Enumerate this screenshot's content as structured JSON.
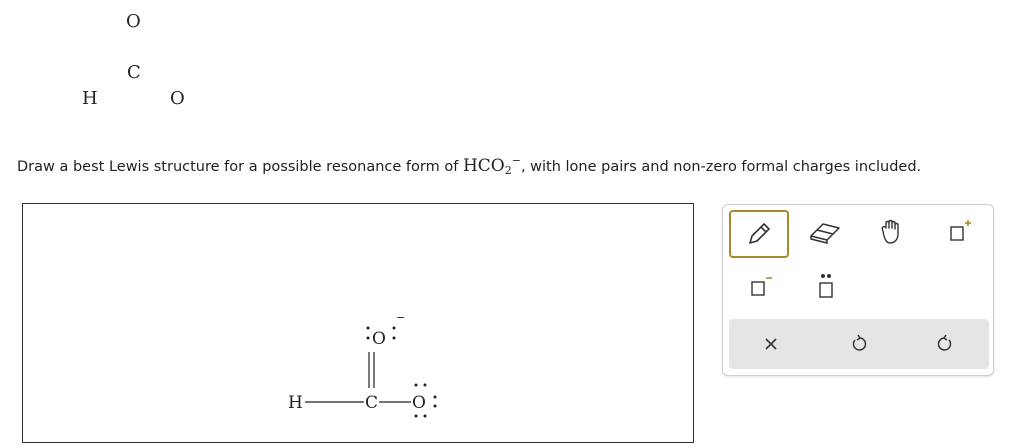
{
  "atoms": {
    "o_top": "O",
    "c": "C",
    "h": "H",
    "o_right": "O"
  },
  "question": {
    "prefix": "Draw a best Lewis structure for a possible resonance form of ",
    "formula_main": "HCO",
    "formula_sub": "2",
    "formula_charge": "−",
    "suffix": ", with lone pairs and non-zero formal charges included."
  },
  "structure": {
    "h": "H",
    "c": "C",
    "o_top": "O",
    "o_right": "O",
    "charge_top": "−"
  },
  "toolbox": {
    "tools": [
      "pencil-icon",
      "eraser-icon",
      "hand-icon",
      "positive-charge-icon",
      "negative-charge-icon",
      "lone-pair-icon"
    ],
    "actions": [
      "clear-icon",
      "undo-icon",
      "redo-icon"
    ],
    "accent": "#a88a2b"
  }
}
